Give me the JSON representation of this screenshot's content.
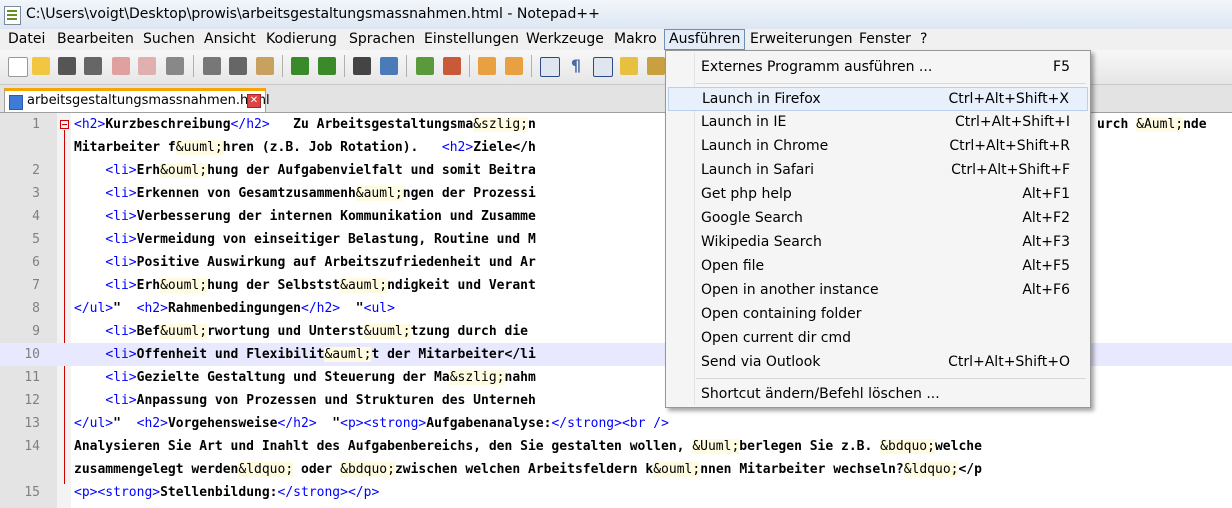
{
  "window": {
    "title": "C:\\Users\\voigt\\Desktop\\prowis\\arbeitsgestaltungsmassnahmen.html - Notepad++"
  },
  "menubar": [
    {
      "label": "Datei"
    },
    {
      "label": "Bearbeiten"
    },
    {
      "label": "Suchen"
    },
    {
      "label": "Ansicht"
    },
    {
      "label": "Kodierung"
    },
    {
      "label": "Sprachen"
    },
    {
      "label": "Einstellungen"
    },
    {
      "label": "Werkzeuge"
    },
    {
      "label": "Makro"
    },
    {
      "label": "Ausführen"
    },
    {
      "label": "Erweiterungen"
    },
    {
      "label": "Fenster"
    },
    {
      "label": "?"
    }
  ],
  "tab": {
    "label": "arbeitsgestaltungsmassnahmen.html"
  },
  "editor": {
    "lines": [
      {
        "num": "1",
        "text": "<h2>Kurzbeschreibung</h2>   Zu Arbeitsgestaltungsma&szlig;n"
      },
      {
        "num": "",
        "text": "Mitarbeiter f&uuml;hren (z.B. Job Rotation).   <h2>Ziele</h"
      },
      {
        "num": "2",
        "text": "    <li>Erh&ouml;hung der Aufgabenvielfalt und somit Beitra"
      },
      {
        "num": "3",
        "text": "    <li>Erkennen von Gesamtzusammenh&auml;ngen der Prozessi"
      },
      {
        "num": "4",
        "text": "    <li>Verbesserung der internen Kommunikation und Zusamme"
      },
      {
        "num": "5",
        "text": "    <li>Vermeidung von einseitiger Belastung, Routine und M"
      },
      {
        "num": "6",
        "text": "    <li>Positive Auswirkung auf Arbeitszufriedenheit und Ar"
      },
      {
        "num": "7",
        "text": "    <li>Erh&ouml;hung der Selbstst&auml;ndigkeit und Verant"
      },
      {
        "num": "8",
        "text": "</ul>\"  <h2>Rahmenbedingungen</h2>  \"<ul>"
      },
      {
        "num": "9",
        "text": "    <li>Bef&uuml;rwortung und Unterst&uuml;tzung durch die"
      },
      {
        "num": "10",
        "text": "    <li>Offenheit und Flexibilit&auml;t der Mitarbeiter</li"
      },
      {
        "num": "11",
        "text": "    <li>Gezielte Gestaltung und Steuerung der Ma&szlig;nahm"
      },
      {
        "num": "12",
        "text": "    <li>Anpassung von Prozessen und Strukturen des Unterneh"
      },
      {
        "num": "13",
        "text": "</ul>\"  <h2>Vorgehensweise</h2>  \"<p><strong>Aufgabenanalyse:</strong><br />"
      },
      {
        "num": "14",
        "text": "Analysieren Sie Art und Inahlt des Aufgabenbereichs, den Sie gestalten wollen, &Uuml;berlegen Sie z.B. &bdquo;welche"
      },
      {
        "num": "",
        "text": "zusammengelegt werden&ldquo; oder &bdquo;zwischen welchen Arbeitsfeldern k&ouml;nnen Mitarbeiter wechseln?&ldquo;</p"
      },
      {
        "num": "15",
        "text": "<p><strong>Stellenbildung:</strong></p>"
      }
    ],
    "line1_tail": "urch &Auml;nde"
  },
  "run_menu": {
    "items": [
      {
        "label": "Externes Programm ausführen ...",
        "shortcut": "F5"
      },
      {
        "label": "Launch in Firefox",
        "shortcut": "Ctrl+Alt+Shift+X"
      },
      {
        "label": "Launch in IE",
        "shortcut": "Ctrl+Alt+Shift+I"
      },
      {
        "label": "Launch in Chrome",
        "shortcut": "Ctrl+Alt+Shift+R"
      },
      {
        "label": "Launch in Safari",
        "shortcut": "Ctrl+Alt+Shift+F"
      },
      {
        "label": "Get php help",
        "shortcut": "Alt+F1"
      },
      {
        "label": "Google Search",
        "shortcut": "Alt+F2"
      },
      {
        "label": "Wikipedia Search",
        "shortcut": "Alt+F3"
      },
      {
        "label": "Open file",
        "shortcut": "Alt+F5"
      },
      {
        "label": "Open in another instance",
        "shortcut": "Alt+F6"
      },
      {
        "label": "Open containing folder",
        "shortcut": ""
      },
      {
        "label": "Open current dir cmd",
        "shortcut": ""
      },
      {
        "label": "Send via Outlook",
        "shortcut": "Ctrl+Alt+Shift+O"
      },
      {
        "label": "Shortcut ändern/Befehl löschen ...",
        "shortcut": ""
      }
    ]
  },
  "icons": [
    "notepad-icon",
    "new-file-icon",
    "open-file-icon",
    "save-icon",
    "save-all-icon",
    "close-icon",
    "close-all-icon",
    "print-icon",
    "cut-icon",
    "copy-icon",
    "paste-icon",
    "undo-icon",
    "redo-icon",
    "find-icon",
    "replace-icon",
    "zoom-in-icon",
    "zoom-out-icon",
    "sync-v-icon",
    "sync-h-icon",
    "word-wrap-icon",
    "all-chars-icon",
    "indent-guide-icon",
    "doc-map-icon",
    "function-list-icon"
  ]
}
